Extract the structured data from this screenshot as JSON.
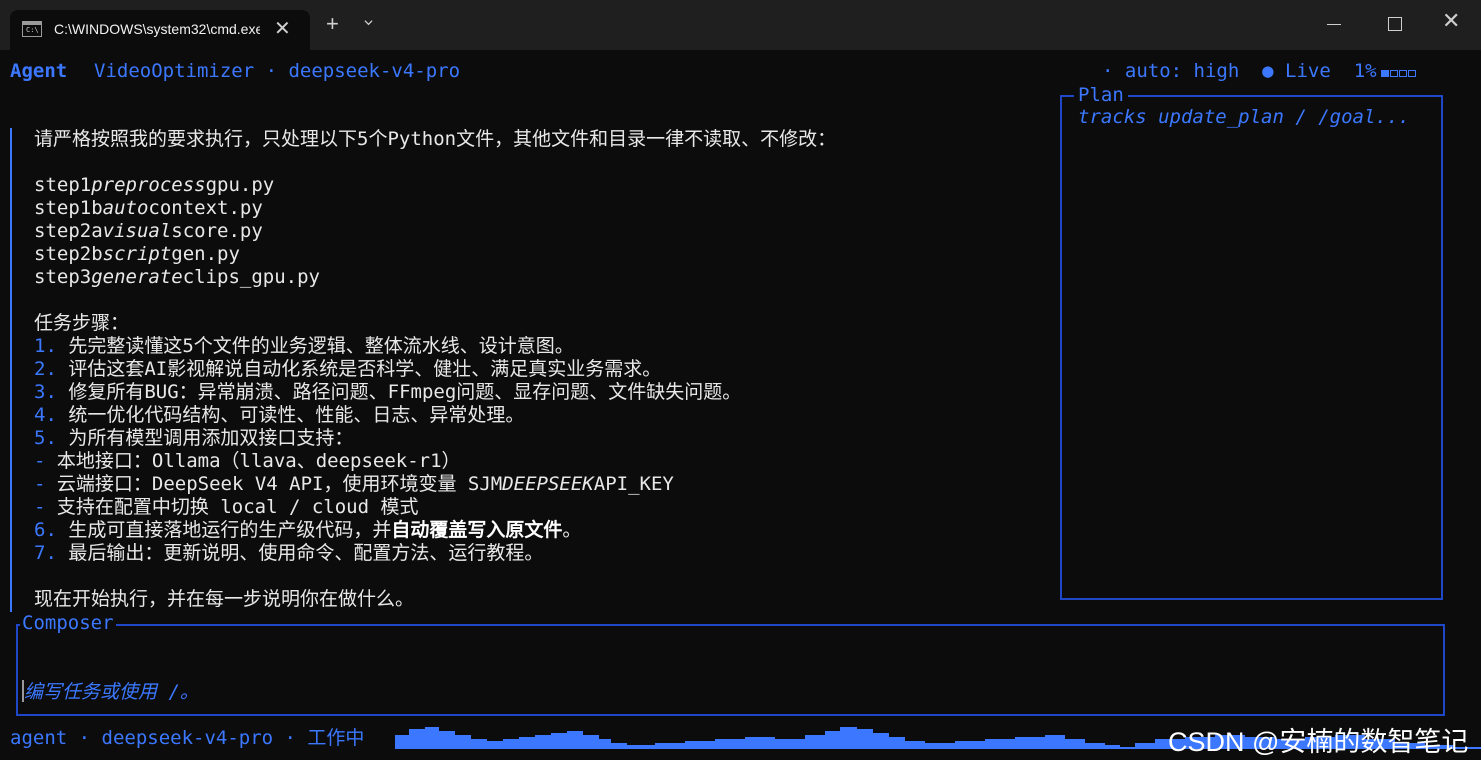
{
  "window": {
    "tab_title": "C:\\WINDOWS\\system32\\cmd.exe",
    "new_tab_symbol": "+",
    "close_symbol": "✕"
  },
  "header": {
    "agent_label": "Agent",
    "project": "VideoOptimizer · deepseek-v4-pro",
    "auto_status": "· auto: high",
    "live_status": "● Live",
    "usage_percent": "1%",
    "usage_fraction": 0.01
  },
  "message": {
    "intro": "请严格按照我的要求执行，只处理以下5个Python文件，其他文件和目录一律不读取、不修改：",
    "files": [
      {
        "a": "step1",
        "b": "preprocess",
        "c": "gpu.py"
      },
      {
        "a": "step1b",
        "b": "auto",
        "c": "context.py"
      },
      {
        "a": "step2a",
        "b": "visual",
        "c": "score.py"
      },
      {
        "a": "step2b",
        "b": "script",
        "c": "gen.py"
      },
      {
        "a": "step3",
        "b": "generate",
        "c": "clips_gpu.py"
      }
    ],
    "steps_title": "任务步骤：",
    "step1_num": "1.",
    "step1": " 先完整读懂这5个文件的业务逻辑、整体流水线、设计意图。",
    "step2_num": "2.",
    "step2": " 评估这套AI影视解说自动化系统是否科学、健壮、满足真实业务需求。",
    "step3_num": "3.",
    "step3": " 修复所有BUG：异常崩溃、路径问题、FFmpeg问题、显存问题、文件缺失问题。",
    "step4_num": "4.",
    "step4": " 统一优化代码结构、可读性、性能、日志、异常处理。",
    "step5_num": "5.",
    "step5": " 为所有模型调用添加双接口支持：",
    "sub_dash": "-",
    "sub1": " 本地接口：Ollama（llava、deepseek-r1）",
    "sub2_pre": " 云端接口：DeepSeek V4 API，使用环境变量 SJM",
    "sub2_it": "DEEPSEEK",
    "sub2_post": "API_KEY",
    "sub3": " 支持在配置中切换 local / cloud 模式",
    "step6_num": "6.",
    "step6": " 生成可直接落地运行的生产级代码，并",
    "step6_bold": "自动覆盖写入原文件",
    "step6_end": "。",
    "step7_num": "7.",
    "step7": " 最后输出：更新说明、使用命令、配置方法、运行教程。",
    "outro": "现在开始执行，并在每一步说明你在做什么。"
  },
  "plan": {
    "title": "Plan",
    "body": "tracks update_plan / /goal..."
  },
  "composer": {
    "title": "Composer",
    "placeholder": "编写任务或使用 /。"
  },
  "status_bar": {
    "text": "agent · deepseek-v4-pro · 工作中"
  },
  "watermark": "CSDN @安楠的数智笔记",
  "colors": {
    "accent": "#3b78ff",
    "border": "#1f47c8",
    "background": "#0c0c0c",
    "text": "#e8e8e8"
  }
}
